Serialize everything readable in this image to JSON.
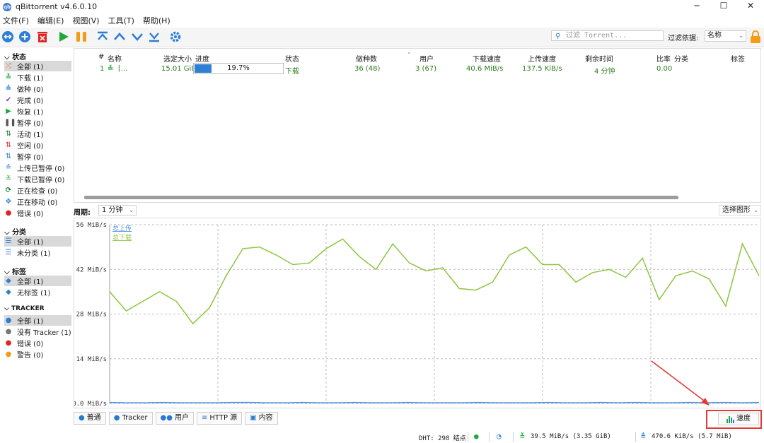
{
  "window": {
    "title": "qBittorrent v4.6.0.10",
    "app_icon": "qb",
    "minimize": "─",
    "maximize": "☐",
    "close": "✕"
  },
  "menu": [
    "文件(F)",
    "编辑(E)",
    "视图(V)",
    "工具(T)",
    "帮助(H)"
  ],
  "toolbar": {
    "icons": [
      "add-link-icon",
      "add-torrent-icon",
      "delete-icon",
      "resume-icon",
      "pause-icon",
      "move-top-icon",
      "move-up-icon",
      "move-down-icon",
      "move-bottom-icon",
      "options-icon"
    ],
    "search_placeholder": "过滤 Torrent...",
    "filter_label": "过滤依据:",
    "filter_value": "名称"
  },
  "sidebar": {
    "status_header": "状态",
    "status": [
      "全部 (1)",
      "下载 (1)",
      "做种 (0)",
      "完成 (0)",
      "恢复 (1)",
      "暂停 (0)",
      "活动 (1)",
      "空闲 (0)",
      "暂停 (0)",
      "上传已暂停 (0)",
      "下载已暂停 (0)",
      "正在检查 (0)",
      "正在移动 (0)",
      "错误 (0)"
    ],
    "category_header": "分类",
    "categories": [
      "全部 (1)",
      "未分类 (1)"
    ],
    "tags_header": "标签",
    "tags": [
      "全部 (1)",
      "无标签 (1)"
    ],
    "tracker_header": "TRACKER",
    "trackers": [
      "全部 (1)",
      "没有 Tracker (1)",
      "错误 (0)",
      "警告 (0)"
    ]
  },
  "torrent_table": {
    "headers": [
      "#",
      "名称",
      "选定大小",
      "进度",
      "状态",
      "做种数",
      "用户",
      "下载速度",
      "上传速度",
      "剩余时间",
      "比率",
      "分类",
      "标签"
    ],
    "row": {
      "index": "1",
      "name": "[...",
      "size": "15.01 GiB",
      "progress_text": "19.7%",
      "progress": 0.197,
      "status": "下载",
      "seeds": "36 (48)",
      "peers": "3 (67)",
      "down_speed": "40.6 MiB/s",
      "up_speed": "137.5 KiB/s",
      "eta": "4 分钟",
      "ratio": "0.00"
    }
  },
  "graph": {
    "period_label": "周期:",
    "period_value": "1 分钟",
    "choose_graph": "选择图形"
  },
  "chart_data": {
    "type": "line",
    "ylabel_ticks": [
      "56 MiB/s",
      "42 MiB/s",
      "28 MiB/s",
      "14 MiB/s",
      "0.0 MiB/s"
    ],
    "ylim": [
      0,
      56
    ],
    "legend": [
      "总上传",
      "总下载"
    ],
    "legend_placement": "top-left",
    "grid": true,
    "series": [
      {
        "name": "总上传",
        "color": "#4a8fe0",
        "values": [
          0.3,
          0.2,
          0.2,
          0.3,
          0.2,
          0.2,
          0.2,
          0.3,
          0.3,
          0.2,
          0.2,
          0.3,
          0.2,
          0.2,
          0.3,
          0.2,
          0.2,
          0.3,
          0.2,
          0.2,
          0.2,
          0.3,
          0.2,
          0.2,
          0.2,
          0.3,
          0.2,
          0.2,
          0.3,
          0.2,
          0.3,
          0.2,
          0.2,
          0.3,
          0.2,
          0.3,
          0.2,
          0.3
        ]
      },
      {
        "name": "总下载",
        "color": "#8cc63f",
        "values": [
          35,
          29,
          32,
          35,
          32,
          25,
          30,
          40,
          48.5,
          49,
          46.5,
          43.5,
          44,
          48.5,
          51.5,
          46,
          42,
          50,
          44,
          41.5,
          42.5,
          36,
          35.5,
          38,
          46.5,
          49,
          43.5,
          43.5,
          38,
          41,
          42,
          39.5,
          45.5,
          32.5,
          40,
          41.5,
          39,
          30.5,
          50,
          40
        ]
      }
    ]
  },
  "bottom_tabs": [
    {
      "icon": "info-icon",
      "label": "普通"
    },
    {
      "icon": "tracker-icon",
      "label": "Tracker"
    },
    {
      "icon": "peers-icon",
      "label": "用户"
    },
    {
      "icon": "http-source-icon",
      "label": "HTTP 源"
    },
    {
      "icon": "content-icon",
      "label": "内容"
    }
  ],
  "speed_tab": "速度",
  "statusbar": {
    "dht": "DHT: 298 结点",
    "down": "39.5 MiB/s (3.35 GiB)",
    "up": "470.6 KiB/s (5.7 MiB)"
  }
}
